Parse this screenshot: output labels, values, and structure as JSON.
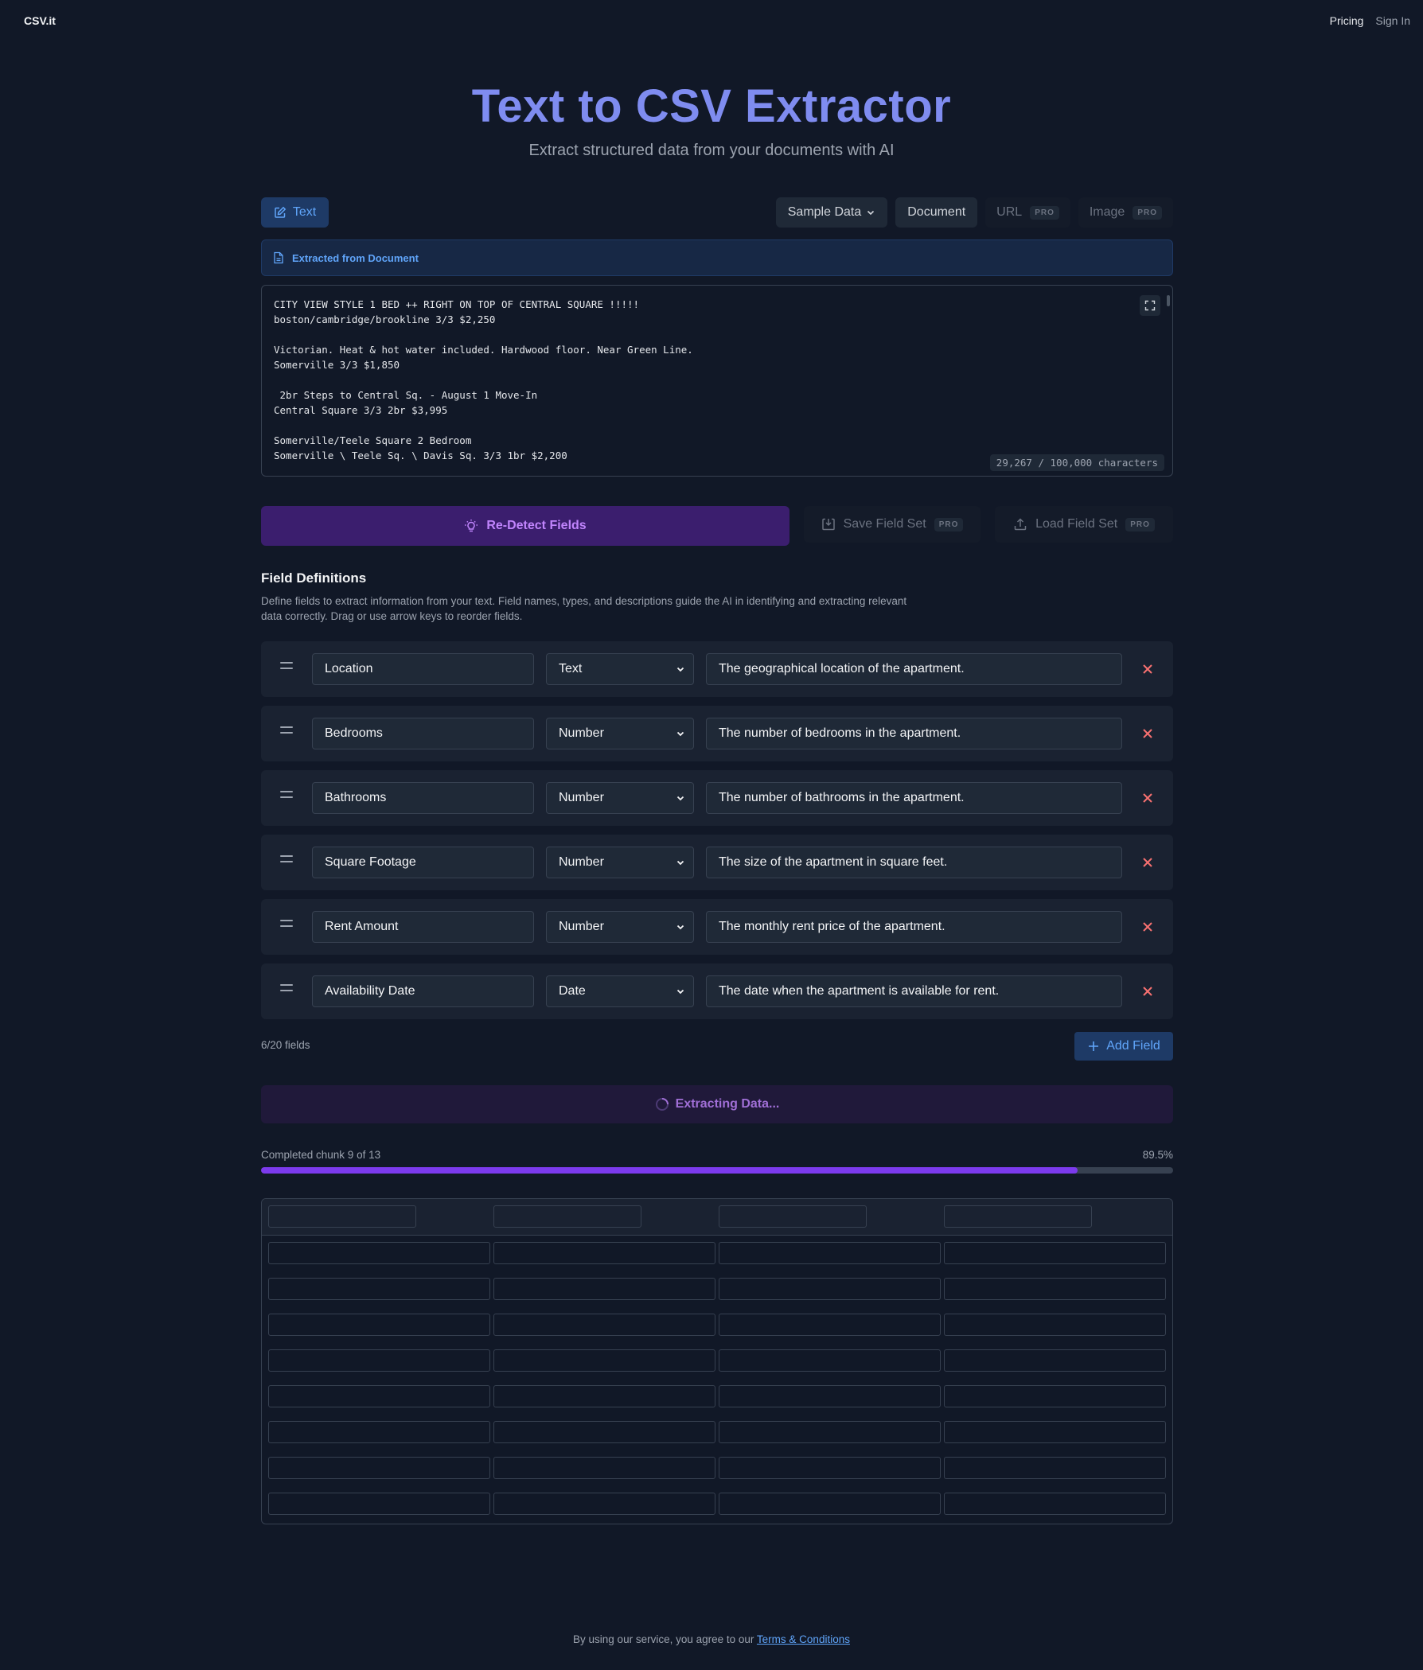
{
  "nav": {
    "brand": "CSV.it",
    "pricing": "Pricing",
    "sign_in": "Sign In"
  },
  "hero": {
    "title": "Text to CSV Extractor",
    "subtitle": "Extract structured data from your documents with AI"
  },
  "tabs": {
    "text": "Text",
    "sample_data": "Sample Data",
    "document": "Document",
    "url": "URL",
    "image": "Image",
    "pro_badge": "PRO"
  },
  "banner": {
    "label": "Extracted from Document"
  },
  "input": {
    "content": "CITY VIEW STYLE 1 BED ++ RIGHT ON TOP OF CENTRAL SQUARE !!!!!\nboston/cambridge/brookline 3/3 $2,250\n\nVictorian. Heat & hot water included. Hardwood floor. Near Green Line.\nSomerville 3/3 $1,850\n\n 2br Steps to Central Sq. - August 1 Move-In\nCentral Square 3/3 2br $3,995\n\nSomerville/Teele Square 2 Bedroom\nSomerville \\ Teele Sq. \\ Davis Sq. 3/3 1br $2,200",
    "char_count": "29,267 / 100,000 characters"
  },
  "actions": {
    "redetect": "Re-Detect Fields",
    "save": "Save Field Set",
    "load": "Load Field Set"
  },
  "fields_section": {
    "title": "Field Definitions",
    "description": "Define fields to extract information from your text. Field names, types, and descriptions guide the AI in identifying and extracting relevant data correctly. Drag or use arrow keys to reorder fields.",
    "count": "6/20 fields",
    "add_label": "Add Field"
  },
  "fields": [
    {
      "name": "Location",
      "type": "Text",
      "description": "The geographical location of the apartment."
    },
    {
      "name": "Bedrooms",
      "type": "Number",
      "description": "The number of bedrooms in the apartment."
    },
    {
      "name": "Bathrooms",
      "type": "Number",
      "description": "The number of bathrooms in the apartment."
    },
    {
      "name": "Square Footage",
      "type": "Number",
      "description": "The size of the apartment in square feet."
    },
    {
      "name": "Rent Amount",
      "type": "Number",
      "description": "The monthly rent price of the apartment."
    },
    {
      "name": "Availability Date",
      "type": "Date",
      "description": "The date when the apartment is available for rent."
    }
  ],
  "extraction": {
    "status": "Extracting Data...",
    "progress_label": "Completed chunk 9 of 13",
    "progress_pct_text": "89.5%",
    "progress": 0.895
  },
  "footer": {
    "text": "By using our service, you agree to our ",
    "link": "Terms & Conditions"
  },
  "colors": {
    "background": "#111827",
    "accent_blue": "#60a5fa",
    "accent_purple": "#7c3aed",
    "delete_red": "#f87171",
    "title": "#7f8cf0"
  }
}
